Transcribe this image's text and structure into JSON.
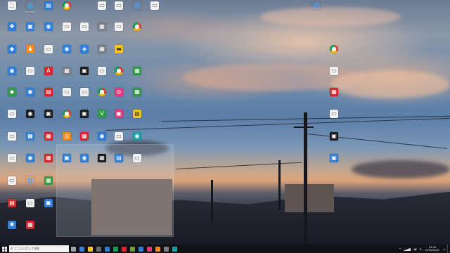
{
  "taskbar": {
    "search_placeholder": "ここに入力して検索",
    "apps": [
      {
        "name": "task-view",
        "color": "#9aa3ad"
      },
      {
        "name": "edge",
        "color": "#2f7fd8"
      },
      {
        "name": "file-explorer",
        "color": "#f3c51d"
      },
      {
        "name": "store",
        "color": "#6a6a6a"
      },
      {
        "name": "mail",
        "color": "#2f7fd8"
      },
      {
        "name": "chrome",
        "color": "#0f9d58"
      },
      {
        "name": "app-7",
        "color": "#d9262b"
      },
      {
        "name": "app-8",
        "color": "#6b9c2e"
      },
      {
        "name": "app-9",
        "color": "#2f7fd8"
      },
      {
        "name": "app-10",
        "color": "#e5397c"
      },
      {
        "name": "app-11",
        "color": "#f08a1c"
      },
      {
        "name": "app-12",
        "color": "#7b7f88"
      },
      {
        "name": "app-13",
        "color": "#1aa3a8"
      }
    ],
    "tray_text": "^",
    "ime": "A",
    "clock_time": "12:00",
    "clock_date": "2019/10/01"
  },
  "icons": [
    {
      "id": "ic1",
      "glyph": "⬚",
      "style": "ico-doc",
      "label": ""
    },
    {
      "id": "ic2",
      "glyph": "e",
      "style": "ico-ie",
      "label": "Internet"
    },
    {
      "id": "ic3",
      "glyph": "▤",
      "style": "ico-blue",
      "label": ""
    },
    {
      "id": "ic4",
      "glyph": "●",
      "style": "ico-chrome",
      "label": ""
    },
    {
      "id": "ic5",
      "glyph": "▭",
      "style": "ico-doc",
      "label": ""
    },
    {
      "id": "ic6",
      "glyph": "▭",
      "style": "ico-doc",
      "label": ""
    },
    {
      "id": "ic7",
      "glyph": "⚙",
      "style": "ico-gear",
      "label": ""
    },
    {
      "id": "ic8",
      "glyph": "▭",
      "style": "ico-doc",
      "label": ""
    },
    {
      "id": "ic9",
      "glyph": "⚙",
      "style": "ico-gear",
      "label": ""
    },
    {
      "id": "ic10",
      "glyph": "✚",
      "style": "ico-blue",
      "label": ""
    },
    {
      "id": "ic11",
      "glyph": "▣",
      "style": "ico-blue",
      "label": ""
    },
    {
      "id": "ic12",
      "glyph": "◉",
      "style": "ico-blue",
      "label": ""
    },
    {
      "id": "ic13",
      "glyph": "▭",
      "style": "ico-doc",
      "label": ""
    },
    {
      "id": "ic14",
      "glyph": "▭",
      "style": "ico-doc",
      "label": ""
    },
    {
      "id": "ic15",
      "glyph": "▦",
      "style": "ico-gray",
      "label": ""
    },
    {
      "id": "ic16",
      "glyph": "▭",
      "style": "ico-doc",
      "label": ""
    },
    {
      "id": "ic17",
      "glyph": "●",
      "style": "ico-chrome",
      "label": ""
    },
    {
      "id": "ic18",
      "glyph": "◆",
      "style": "ico-blue",
      "label": ""
    },
    {
      "id": "ic19",
      "glyph": "♟",
      "style": "ico-orange",
      "label": ""
    },
    {
      "id": "ic20",
      "glyph": "▭",
      "style": "ico-doc",
      "label": ""
    },
    {
      "id": "ic21",
      "glyph": "◉",
      "style": "ico-blue",
      "label": ""
    },
    {
      "id": "ic22",
      "glyph": "◈",
      "style": "ico-blue",
      "label": ""
    },
    {
      "id": "ic23",
      "glyph": "▦",
      "style": "ico-gray",
      "label": ""
    },
    {
      "id": "ic24",
      "glyph": "▬",
      "style": "ico-yellow",
      "label": ""
    },
    {
      "id": "ic25",
      "glyph": "●",
      "style": "ico-chrome",
      "label": ""
    },
    {
      "id": "ic26",
      "glyph": "◉",
      "style": "ico-blue",
      "label": ""
    },
    {
      "id": "ic27",
      "glyph": "▭",
      "style": "ico-doc",
      "label": ""
    },
    {
      "id": "ic28",
      "glyph": "A",
      "style": "ico-red",
      "label": ""
    },
    {
      "id": "ic29",
      "glyph": "▦",
      "style": "ico-gray",
      "label": ""
    },
    {
      "id": "ic30",
      "glyph": "▣",
      "style": "ico-black",
      "label": ""
    },
    {
      "id": "ic31",
      "glyph": "▭",
      "style": "ico-doc",
      "label": ""
    },
    {
      "id": "ic32",
      "glyph": "●",
      "style": "ico-chrome",
      "label": ""
    },
    {
      "id": "ic33",
      "glyph": "▦",
      "style": "ico-green",
      "label": ""
    },
    {
      "id": "ic34",
      "glyph": "▭",
      "style": "ico-doc",
      "label": ""
    },
    {
      "id": "ic35",
      "glyph": "◆",
      "style": "ico-green",
      "label": ""
    },
    {
      "id": "ic36",
      "glyph": "◉",
      "style": "ico-blue",
      "label": ""
    },
    {
      "id": "ic37",
      "glyph": "▤",
      "style": "ico-red",
      "label": ""
    },
    {
      "id": "ic38",
      "glyph": "▭",
      "style": "ico-doc",
      "label": ""
    },
    {
      "id": "ic39",
      "glyph": "▭",
      "style": "ico-doc",
      "label": ""
    },
    {
      "id": "ic40",
      "glyph": "●",
      "style": "ico-chrome",
      "label": ""
    },
    {
      "id": "ic41",
      "glyph": "◎",
      "style": "ico-pink",
      "label": ""
    },
    {
      "id": "ic42",
      "glyph": "▦",
      "style": "ico-green",
      "label": ""
    },
    {
      "id": "ic43",
      "glyph": "▦",
      "style": "ico-red",
      "label": ""
    },
    {
      "id": "ic44",
      "glyph": "▭",
      "style": "ico-doc",
      "label": ""
    },
    {
      "id": "ic45",
      "glyph": "◉",
      "style": "ico-black",
      "label": ""
    },
    {
      "id": "ic46",
      "glyph": "▣",
      "style": "ico-black",
      "label": ""
    },
    {
      "id": "ic47",
      "glyph": "●",
      "style": "ico-chrome",
      "label": ""
    },
    {
      "id": "ic48",
      "glyph": "▣",
      "style": "ico-black",
      "label": ""
    },
    {
      "id": "ic49",
      "glyph": "V",
      "style": "ico-green",
      "label": ""
    },
    {
      "id": "ic50",
      "glyph": "▣",
      "style": "ico-pink",
      "label": ""
    },
    {
      "id": "ic51",
      "glyph": "▤",
      "style": "ico-yellow",
      "label": ""
    },
    {
      "id": "ic52",
      "glyph": "▭",
      "style": "ico-doc",
      "label": ""
    },
    {
      "id": "ic53",
      "glyph": "▭",
      "style": "ico-doc",
      "label": ""
    },
    {
      "id": "ic54",
      "glyph": "▦",
      "style": "ico-blue",
      "label": ""
    },
    {
      "id": "ic55",
      "glyph": "▦",
      "style": "ico-red",
      "label": ""
    },
    {
      "id": "ic56",
      "glyph": "◎",
      "style": "ico-orange",
      "label": ""
    },
    {
      "id": "ic57",
      "glyph": "▦",
      "style": "ico-red",
      "label": ""
    },
    {
      "id": "ic58",
      "glyph": "◉",
      "style": "ico-blue",
      "label": ""
    },
    {
      "id": "ic59",
      "glyph": "▭",
      "style": "ico-doc",
      "label": ""
    },
    {
      "id": "ic60",
      "glyph": "◉",
      "style": "ico-teal",
      "label": ""
    },
    {
      "id": "ic61",
      "glyph": "▣",
      "style": "ico-black",
      "label": ""
    },
    {
      "id": "ic62",
      "glyph": "▭",
      "style": "ico-doc",
      "label": ""
    },
    {
      "id": "ic63",
      "glyph": "◉",
      "style": "ico-blue",
      "label": ""
    },
    {
      "id": "ic64",
      "glyph": "▦",
      "style": "ico-red",
      "label": ""
    },
    {
      "id": "ic65",
      "glyph": "▣",
      "style": "ico-blue",
      "label": ""
    },
    {
      "id": "ic66",
      "glyph": "◉",
      "style": "ico-blue",
      "label": ""
    },
    {
      "id": "ic67",
      "glyph": "▦",
      "style": "ico-black",
      "label": ""
    },
    {
      "id": "ic68",
      "glyph": "▤",
      "style": "ico-blue",
      "label": ""
    },
    {
      "id": "ic69",
      "glyph": "▭",
      "style": "ico-doc",
      "label": ""
    },
    {
      "id": "ic70",
      "glyph": "▣",
      "style": "ico-blue",
      "label": ""
    },
    {
      "id": "ic71",
      "glyph": "▭",
      "style": "ico-doc",
      "label": ""
    },
    {
      "id": "ic72",
      "glyph": "⚙",
      "style": "ico-gear",
      "label": ""
    },
    {
      "id": "ic73",
      "glyph": "▦",
      "style": "ico-green",
      "label": ""
    },
    {
      "id": "ic74",
      "glyph": "▤",
      "style": "ico-red",
      "label": ""
    },
    {
      "id": "ic75",
      "glyph": "▭",
      "style": "ico-doc",
      "label": ""
    },
    {
      "id": "ic76",
      "glyph": "▣",
      "style": "ico-blue",
      "label": ""
    },
    {
      "id": "ic77",
      "glyph": "✱",
      "style": "ico-blue",
      "label": ""
    },
    {
      "id": "ic78",
      "glyph": "▦",
      "style": "ico-red",
      "label": ""
    }
  ]
}
